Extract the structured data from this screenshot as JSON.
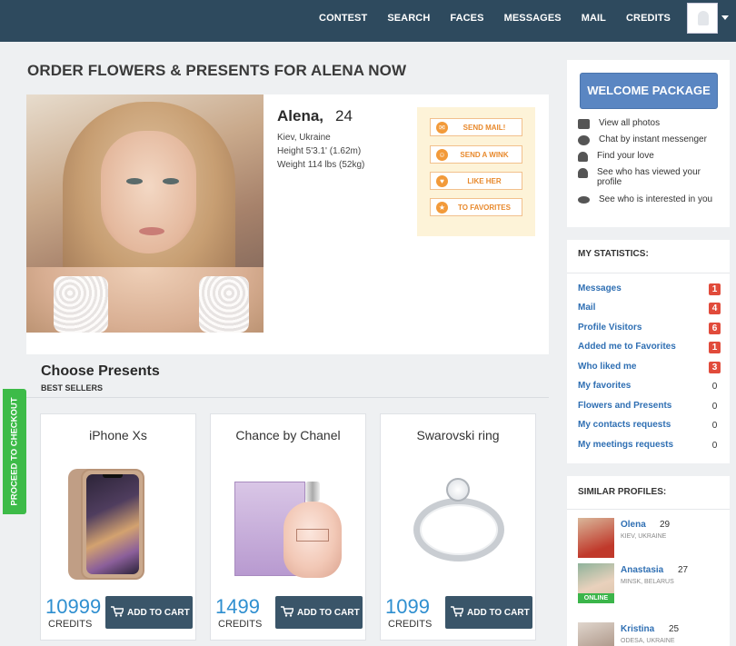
{
  "nav": {
    "items": [
      "CONTEST",
      "SEARCH",
      "FACES",
      "MESSAGES",
      "MAIL",
      "CREDITS"
    ]
  },
  "page": {
    "title": "ORDER FLOWERS & PRESENTS FOR ALENA NOW"
  },
  "profile": {
    "name": "Alena,",
    "age": "24",
    "location": "Kiev, Ukraine",
    "height": "Height 5'3.1' (1.62m)",
    "weight": "Weight 114 lbs (52kg)",
    "actions": [
      {
        "label": "SEND MAIL!",
        "icon": "chat-bubble-icon"
      },
      {
        "label": "SEND A WINK",
        "icon": "smile-icon"
      },
      {
        "label": "LIKE HER",
        "icon": "heart-icon"
      },
      {
        "label": "TO FAVORITES",
        "icon": "star-icon"
      }
    ]
  },
  "presents": {
    "title": "Choose Presents",
    "subtitle": "BEST SELLERS",
    "items": [
      {
        "name": "iPhone Xs",
        "price": "10999",
        "unit": "CREDITS",
        "button": "ADD TO CART"
      },
      {
        "name": "Chance by Chanel",
        "price": "1499",
        "unit": "CREDITS",
        "button": "ADD TO CART"
      },
      {
        "name": "Swarovski ring",
        "price": "1099",
        "unit": "CREDITS",
        "button": "ADD TO CART"
      }
    ]
  },
  "checkout": {
    "label": "PROCEED TO CHECKOUT"
  },
  "sidebar": {
    "welcome_button": "WELCOME PACKAGE",
    "features": [
      {
        "label": "View all photos",
        "icon": "camera-icon"
      },
      {
        "label": "Chat by instant messenger",
        "icon": "chat-icon"
      },
      {
        "label": "Find your love",
        "icon": "user-icon"
      },
      {
        "label": "See who has viewed your profile",
        "icon": "user-icon"
      },
      {
        "label": "See who is interested in you",
        "icon": "eye-icon"
      }
    ],
    "stats": {
      "title": "MY STATISTICS:",
      "rows": [
        {
          "label": "Messages",
          "value": "1",
          "highlight": true
        },
        {
          "label": "Mail",
          "value": "4",
          "highlight": true
        },
        {
          "label": "Profile Visitors",
          "value": "6",
          "highlight": true
        },
        {
          "label": "Added me to Favorites",
          "value": "1",
          "highlight": true
        },
        {
          "label": "Who liked me",
          "value": "3",
          "highlight": true
        },
        {
          "label": "My favorites",
          "value": "0",
          "highlight": false
        },
        {
          "label": "Flowers and Presents",
          "value": "0",
          "highlight": false
        },
        {
          "label": "My contacts requests",
          "value": "0",
          "highlight": false
        },
        {
          "label": "My meetings requests",
          "value": "0",
          "highlight": false
        }
      ]
    },
    "similar": {
      "title": "SIMILAR PROFILES:",
      "profiles": [
        {
          "name": "Olena",
          "age": "29",
          "city": "KIEV, UKRAINE",
          "online": false
        },
        {
          "name": "Anastasia",
          "age": "27",
          "city": "MINSK, BELARUS",
          "online": true,
          "status": "ONLINE"
        },
        {
          "name": "Kristina",
          "age": "25",
          "city": "ODESA, UKRAINE",
          "online": false
        }
      ]
    }
  },
  "colors": {
    "topbar": "#2e4a5e",
    "link": "#2f6fb3",
    "price": "#2f8fd0",
    "badge": "#e14b3b",
    "checkout": "#3dbb48",
    "welcome": "#5a86c2",
    "action_text": "#e8892c"
  }
}
